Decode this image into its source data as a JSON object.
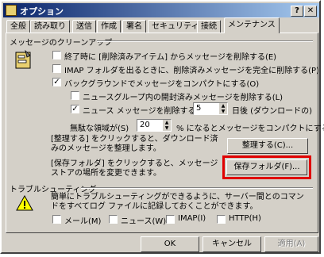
{
  "window": {
    "title": "オプション",
    "help_button": "?",
    "close_button": "✕"
  },
  "tabs": [
    "全般",
    "読み取り",
    "送信",
    "作成",
    "署名",
    "セキュリティ",
    "接続",
    "メンテナンス"
  ],
  "cleanup": {
    "heading": "メッセージのクリーンアップ",
    "opt_delete_read": "終了時に [削除済みアイテム] からメッセージを削除する(E)",
    "opt_imap_purge": "IMAP フォルダを出るときに、削除済みメッセージを完全に削除する(P)",
    "opt_background_compact": "バックグラウンドでメッセージをコンパクトにする(O)",
    "opt_delete_read_news": "ニュースグループ内の開封済みメッセージを削除する(L)",
    "opt_delete_news_days": "ニュース メッセージを削除する(D)",
    "days_value": "5",
    "days_suffix": "日後 (ダウンロードの)",
    "wasted_space_label": "無駄な領域が(S)",
    "wasted_space_value": "20",
    "wasted_space_suffix": "% になるとメッセージをコンパクトにする",
    "cleanup_desc": "[整理する] をクリックすると、ダウンロード済みのメッセージを整理します。",
    "cleanup_button": "整理する(C)...",
    "store_desc": "[保存フォルダ] をクリックすると、メッセージ ストアの場所を変更できます。",
    "store_button": "保存フォルダ(F)..."
  },
  "troubleshoot": {
    "heading": "トラブルシューティング",
    "desc": "簡単にトラブルシューティングができるように、サーバー間とのコマンドをすべてログ ファイルに記録しておくことができます。",
    "log_mail": "メール(M)",
    "log_news": "ニュース(W)",
    "log_imap": "IMAP(I)",
    "log_http": "HTTP(H)"
  },
  "footer": {
    "ok": "OK",
    "cancel": "キャンセル",
    "apply": "適用(A)"
  },
  "colors": {
    "highlight": "#e00000",
    "titlebar": "#0a246a"
  }
}
